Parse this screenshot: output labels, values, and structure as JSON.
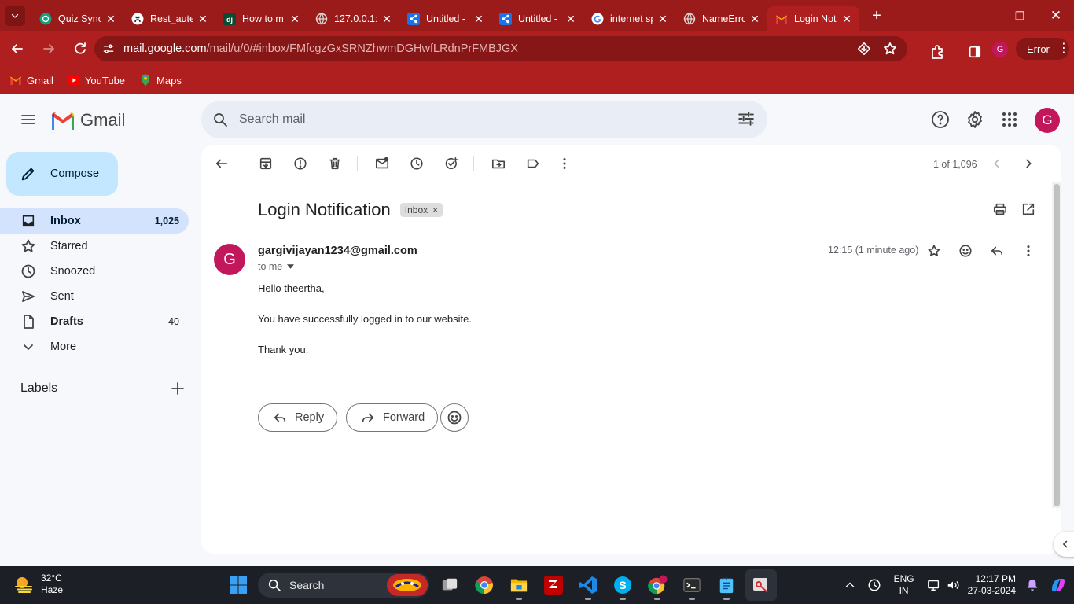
{
  "browser": {
    "tabs": [
      {
        "title": "Quiz Sync",
        "favicon": "chatgpt-icon",
        "active": false
      },
      {
        "title": "Rest_aute",
        "favicon": "github-icon",
        "active": false
      },
      {
        "title": "How to m",
        "favicon": "django-icon",
        "active": false
      },
      {
        "title": "127.0.0.1:",
        "favicon": "globe-icon",
        "active": false
      },
      {
        "title": "Untitled -",
        "favicon": "share-icon",
        "active": false
      },
      {
        "title": "Untitled -",
        "favicon": "share-icon",
        "active": false
      },
      {
        "title": "internet sp",
        "favicon": "google-icon",
        "active": false
      },
      {
        "title": "NameErro",
        "favicon": "globe-icon",
        "active": false
      },
      {
        "title": "Login Not",
        "favicon": "gmail-icon",
        "active": true
      }
    ],
    "url_host": "mail.google.com",
    "url_path": "/mail/u/0/#inbox/FMfcgzGxSRNZhwmDGHwfLRdnPrFMBJGX",
    "profile_initial": "G",
    "error_label": "Error",
    "bookmarks": [
      {
        "label": "Gmail",
        "icon": "gmail-icon"
      },
      {
        "label": "YouTube",
        "icon": "youtube-icon"
      },
      {
        "label": "Maps",
        "icon": "maps-icon"
      }
    ],
    "colors": {
      "frame": "#9b1b1b",
      "toolbar": "#b01f1f",
      "omnibox": "#871616"
    }
  },
  "gmail": {
    "logo_text": "Gmail",
    "search_placeholder": "Search mail",
    "account_initial": "G",
    "compose_label": "Compose",
    "nav": [
      {
        "label": "Inbox",
        "count": "1,025",
        "icon": "inbox-icon",
        "selected": true,
        "bold": true
      },
      {
        "label": "Starred",
        "count": "",
        "icon": "star-icon",
        "selected": false,
        "bold": false
      },
      {
        "label": "Snoozed",
        "count": "",
        "icon": "clock-icon",
        "selected": false,
        "bold": false
      },
      {
        "label": "Sent",
        "count": "",
        "icon": "send-icon",
        "selected": false,
        "bold": false
      },
      {
        "label": "Drafts",
        "count": "40",
        "icon": "draft-icon",
        "selected": false,
        "bold": true
      },
      {
        "label": "More",
        "count": "",
        "icon": "chevron-down-icon",
        "selected": false,
        "bold": false
      }
    ],
    "labels_heading": "Labels",
    "pager": "1 of 1,096",
    "message": {
      "subject": "Login Notification",
      "label_chip": "Inbox",
      "sender": "gargivijayan1234@gmail.com",
      "sender_initial": "G",
      "to_line": "to me",
      "time": "12:15 (1 minute ago)",
      "body": [
        "Hello theertha,",
        "You have successfully logged in to our website.",
        "Thank you."
      ]
    },
    "reply_label": "Reply",
    "forward_label": "Forward",
    "colors": {
      "accent": "#c2e7ff",
      "selected_nav": "#d3e3fd",
      "avatar": "#c2185b"
    }
  },
  "taskbar": {
    "weather_temp": "32°C",
    "weather_desc": "Haze",
    "search_label": "Search",
    "lang_top": "ENG",
    "lang_bottom": "IN",
    "clock_time": "12:17 PM",
    "clock_date": "27-03-2024"
  }
}
